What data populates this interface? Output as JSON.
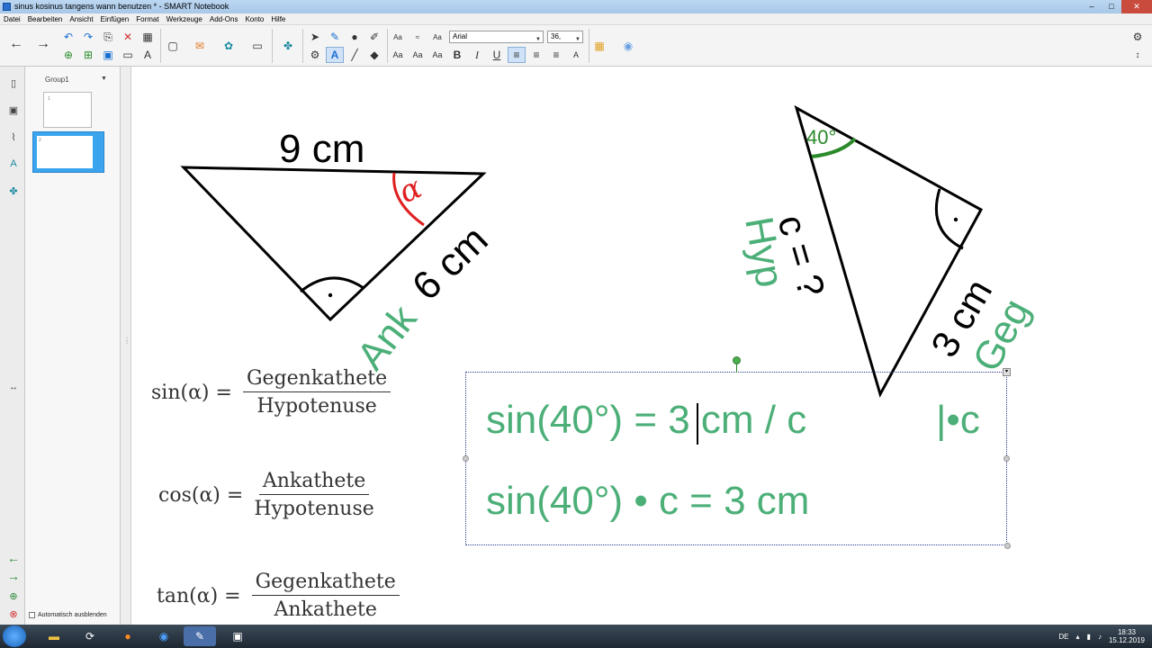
{
  "window": {
    "title": "sinus kosinus tangens wann benutzen * - SMART Notebook",
    "min": "–",
    "max": "□",
    "close": "✕"
  },
  "menu": [
    "Datei",
    "Bearbeiten",
    "Ansicht",
    "Einfügen",
    "Format",
    "Werkzeuge",
    "Add-Ons",
    "Konto",
    "Hilfe"
  ],
  "toolbar": {
    "font_name": "Arial",
    "font_size": "36,",
    "bold": "B",
    "italic": "I",
    "underline": "U",
    "text_tool": "A"
  },
  "sidebar": {
    "group_label": "Group1",
    "autohide_label": "Automatisch ausblenden",
    "page1_number": "1",
    "page2_number": "2"
  },
  "canvas": {
    "left_triangle": {
      "top_label": "9 cm",
      "side_label": "6 cm",
      "ank_label": "Ank",
      "alpha": "α"
    },
    "right_triangle": {
      "angle_label": "40°",
      "hyp_label": "Hyp",
      "c_label": "c = ?",
      "side_label": "3 cm",
      "geg_label": "Geg"
    },
    "formulas": [
      {
        "lhs": "sin(α) =",
        "num": "Gegenkathete",
        "den": "Hypotenuse"
      },
      {
        "lhs": "cos(α) =",
        "num": "Ankathete",
        "den": "Hypotenuse"
      },
      {
        "lhs": "tan(α) =",
        "num": "Gegenkathete",
        "den": "Ankathete"
      }
    ],
    "textbox": {
      "line1": "sin(40°) = 3 cm / c",
      "line1_suffix": "|•c",
      "line2": "sin(40°) • c = 3 cm"
    }
  },
  "taskbar": {
    "language": "DE",
    "time": "18:33",
    "date": "15.12.2019"
  },
  "colors": {
    "green_text": "#4caf78",
    "red_angle": "#e02020",
    "dark_green_angle": "#2a8a2a"
  }
}
